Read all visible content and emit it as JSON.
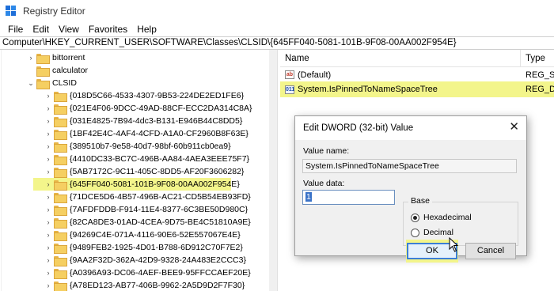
{
  "window": {
    "title": "Registry Editor"
  },
  "menu": [
    "File",
    "Edit",
    "View",
    "Favorites",
    "Help"
  ],
  "address": "Computer\\HKEY_CURRENT_USER\\SOFTWARE\\Classes\\CLSID\\{645FF040-5081-101B-9F08-00AA002F954E}",
  "tree": {
    "top_items": [
      "bittorrent",
      "calculator",
      "CLSID"
    ],
    "clsid_children": [
      "{018D5C66-4533-4307-9B53-224DE2ED1FE6}",
      "{021E4F06-9DCC-49AD-88CF-ECC2DA314C8A}",
      "{031E4825-7B94-4dc3-B131-E946B44C8DD5}",
      "{1BF42E4C-4AF4-4CFD-A1A0-CF2960B8F63E}",
      "{389510b7-9e58-40d7-98bf-60b911cb0ea9}",
      "{4410DC33-BC7C-496B-AA84-4AEA3EEE75F7}",
      "{5AB7172C-9C11-405C-8DD5-AF20F3606282}",
      "{645FF040-5081-101B-9F08-00AA002F954E}",
      "{71DCE5D6-4B57-496B-AC21-CD5B54EB93FD}",
      "{7AFDFDDB-F914-11E4-8377-6C3BE50D980C}",
      "{82CA8DE3-01AD-4CEA-9D75-BE4C51810A9E}",
      "{94269C4E-071A-4116-90E6-52E557067E4E}",
      "{9489FEB2-1925-4D01-B788-6D912C70F7E2}",
      "{9AA2F32D-362A-42D9-9328-24A483E2CCC3}",
      "{A0396A93-DC06-4AEF-BEE9-95FFCCAEF20E}",
      "{A78ED123-AB77-406B-9962-2A5D9D2F7F30}"
    ],
    "selected_child": 7
  },
  "values": {
    "headers": {
      "name": "Name",
      "type": "Type"
    },
    "rows": [
      {
        "icon": "string-value-icon",
        "badge": "ab",
        "name": "(Default)",
        "type": "REG_SZ"
      },
      {
        "icon": "binary-value-icon",
        "badge": "011",
        "name": "System.IsPinnedToNameSpaceTree",
        "type": "REG_DW"
      }
    ]
  },
  "dialog": {
    "title": "Edit DWORD (32-bit) Value",
    "close_glyph": "✕",
    "value_name_label": "Value name:",
    "value_name": "System.IsPinnedToNameSpaceTree",
    "value_data_label": "Value data:",
    "value_data": "1",
    "base_label": "Base",
    "base_options": [
      "Hexadecimal",
      "Decimal"
    ],
    "base_selected": "Hexadecimal",
    "ok_label": "OK",
    "cancel_label": "Cancel"
  },
  "colors": {
    "highlight": "#f3f58b",
    "folder": "#f5cf62",
    "accent": "#3c7fd6"
  }
}
